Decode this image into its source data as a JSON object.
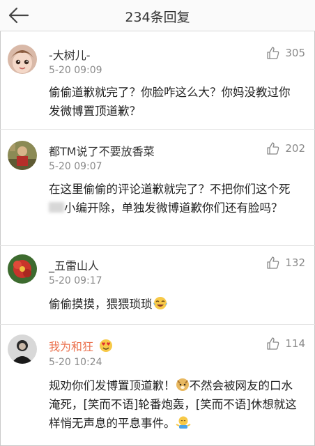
{
  "header": {
    "title": "234条回复"
  },
  "comments": [
    {
      "user": "-大树儿-",
      "time": "5-20 09:09",
      "likes": "305",
      "text": "偷偷道歉就完了？你脸咋这么大？你妈没教过你发微博置顶道歉？"
    },
    {
      "user": "都TM说了不要放香菜",
      "time": "5-20 09:07",
      "likes": "202",
      "text_a": "在这里偷偷的评论道歉就完了？不把你们这个死",
      "text_b": "小编开除，单独发微博道歉你们还有脸吗？"
    },
    {
      "user": "_五雷山人",
      "time": "5-20 09:17",
      "likes": "132",
      "text": "偷偷摸摸，猥猥琐琐"
    },
    {
      "user": "我为和狂",
      "time": "5-20 10:24",
      "likes": "114",
      "text_a": "规劝你们发博置顶道歉！",
      "text_b": "不然会被网友的口水淹死，[笑而不语]轮番炮轰，[笑而不语]休想就这样悄无声息的平息事件。"
    }
  ],
  "colors": {
    "vip_name": "#eb7350",
    "meta": "#8a8a8a",
    "text": "#222222"
  },
  "icons": {
    "back": "back-arrow-icon",
    "like": "thumbs-up-icon"
  }
}
